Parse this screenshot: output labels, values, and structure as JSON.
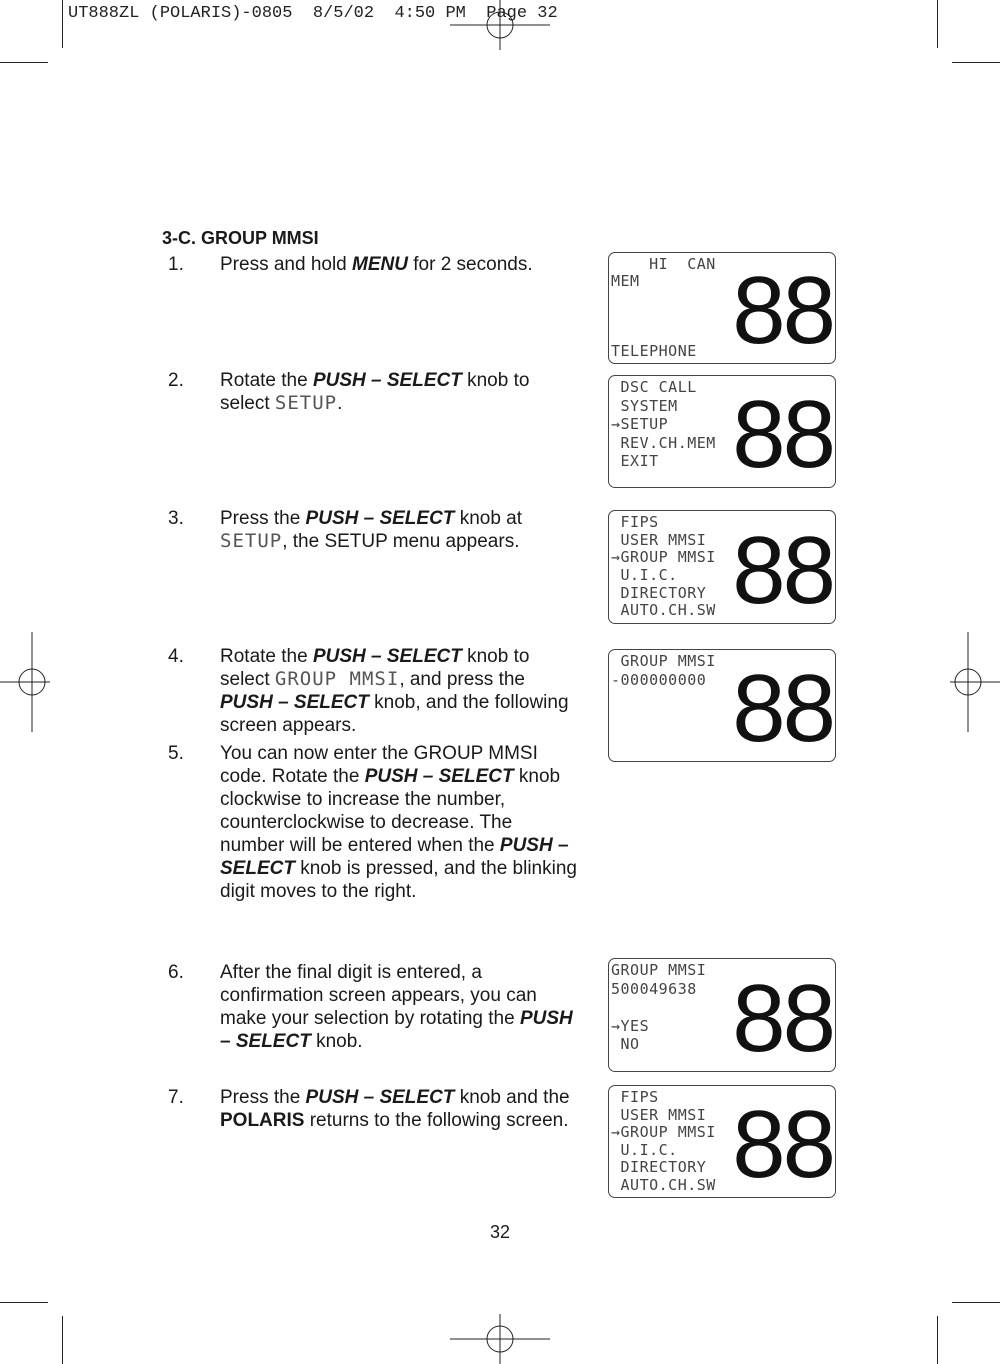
{
  "slug": "UT888ZL (POLARIS)-0805  8/5/02  4:50 PM  Page 32",
  "section_title": "3-C. GROUP MMSI",
  "steps": [
    {
      "num": "1.",
      "parts": [
        [
          "t",
          "Press and hold "
        ],
        [
          "bi",
          "MENU"
        ],
        [
          "t",
          " for 2 seconds."
        ]
      ]
    },
    {
      "num": "2.",
      "parts": [
        [
          "t",
          "Rotate the "
        ],
        [
          "bi",
          "PUSH – SELECT"
        ],
        [
          "t",
          " knob to select "
        ],
        [
          "lcd",
          "SETUP"
        ],
        [
          "t",
          "."
        ]
      ]
    },
    {
      "num": "3.",
      "parts": [
        [
          "t",
          "Press the "
        ],
        [
          "bi",
          "PUSH – SELECT"
        ],
        [
          "t",
          " knob at "
        ],
        [
          "lcd",
          "SETUP"
        ],
        [
          "t",
          ", the SETUP menu appears."
        ]
      ]
    },
    {
      "num": "4.",
      "parts": [
        [
          "t",
          "Rotate the "
        ],
        [
          "bi",
          "PUSH – SELECT"
        ],
        [
          "t",
          " knob to select "
        ],
        [
          "lcd",
          "GROUP MMSI"
        ],
        [
          "t",
          ", and press the "
        ],
        [
          "bi",
          "PUSH – SELECT"
        ],
        [
          "t",
          " knob, and the following screen appears."
        ]
      ]
    },
    {
      "num": "5.",
      "parts": [
        [
          "t",
          "You can now enter the GROUP MMSI code.  Rotate the "
        ],
        [
          "bi",
          "PUSH – SELECT"
        ],
        [
          "t",
          " knob clockwise to increase the number, counterclockwise to decrease.  The number will be entered when the "
        ],
        [
          "bi",
          "PUSH – SELECT"
        ],
        [
          "t",
          " knob is pressed, and the blinking digit moves to the right."
        ]
      ]
    },
    {
      "num": "6.",
      "parts": [
        [
          "t",
          "After the final digit is entered, a confirmation screen appears, you can make your selection by rotating the "
        ],
        [
          "bi",
          "PUSH – SELECT"
        ],
        [
          "t",
          " knob."
        ]
      ]
    },
    {
      "num": "7.",
      "parts": [
        [
          "t",
          "Press the "
        ],
        [
          "bi",
          "PUSH – SELECT"
        ],
        [
          "t",
          " knob and the "
        ],
        [
          "b",
          "POLARIS"
        ],
        [
          "t",
          " returns to the following screen."
        ]
      ]
    }
  ],
  "screens": [
    {
      "lines": [
        "    HI  CAN",
        "MEM",
        "",
        "",
        "",
        "TELEPHONE"
      ],
      "big": "88"
    },
    {
      "lines": [
        " DSC CALL",
        " SYSTEM",
        "→SETUP",
        " REV.CH.MEM",
        " EXIT"
      ],
      "big": "88"
    },
    {
      "lines": [
        " FIPS",
        " USER MMSI",
        "→GROUP MMSI",
        " U.I.C.",
        " DIRECTORY",
        " AUTO.CH.SW"
      ],
      "big": "88"
    },
    {
      "lines": [
        " GROUP MMSI",
        "-000000000"
      ],
      "big": "88"
    },
    {
      "lines": [
        "GROUP MMSI",
        "500049638",
        "",
        "→YES",
        " NO"
      ],
      "big": "88"
    },
    {
      "lines": [
        " FIPS",
        " USER MMSI",
        "→GROUP MMSI",
        " U.I.C.",
        " DIRECTORY",
        " AUTO.CH.SW"
      ],
      "big": "88"
    }
  ],
  "page_number": "32"
}
